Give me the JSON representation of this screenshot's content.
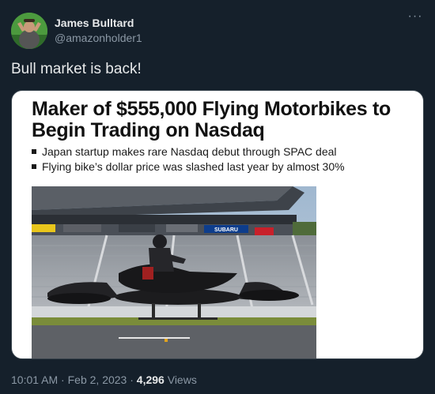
{
  "author": {
    "display_name": "James Bulltard",
    "handle": "@amazonholder1"
  },
  "tweet": {
    "text": "Bull market is back!"
  },
  "embedded_article": {
    "headline": "Maker of $555,000 Flying Motorbikes to Begin Trading on Nasdaq",
    "bullets": [
      "Japan startup makes rare Nasdaq debut through SPAC deal",
      "Flying bike’s dollar price was slashed last year by almost 30%"
    ],
    "photo_signage": [
      "SUBARU"
    ]
  },
  "meta": {
    "time": "10:01 AM",
    "separator": "·",
    "date": "Feb 2, 2023",
    "views_count": "4,296",
    "views_label": "Views"
  },
  "icons": {
    "more": "more-options-icon"
  },
  "colors": {
    "background": "#15202b",
    "primary_text": "#e7e9ea",
    "secondary_text": "#8b98a5",
    "card_background": "#ffffff"
  }
}
